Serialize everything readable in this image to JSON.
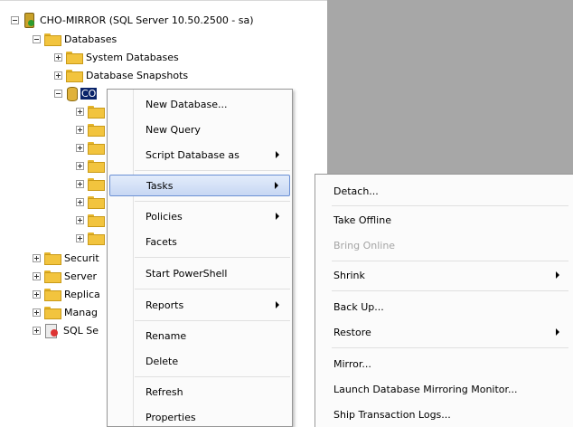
{
  "tree": {
    "server_label": "CHO-MIRROR (SQL Server 10.50.2500 - sa)",
    "databases_label": "Databases",
    "system_databases_label": "System Databases",
    "database_snapshots_label": "Database Snapshots",
    "selected_db_label": "CO",
    "partial_nodes": [
      {
        "label": "Securit"
      },
      {
        "label": "Server"
      },
      {
        "label": "Replica"
      },
      {
        "label": "Manag"
      },
      {
        "label": "SQL Se"
      }
    ]
  },
  "context_menu": {
    "items": [
      {
        "label": "New Database..."
      },
      {
        "label": "New Query"
      },
      {
        "label": "Script Database as"
      },
      {
        "label": "Tasks"
      },
      {
        "label": "Policies"
      },
      {
        "label": "Facets"
      },
      {
        "label": "Start PowerShell"
      },
      {
        "label": "Reports"
      },
      {
        "label": "Rename"
      },
      {
        "label": "Delete"
      },
      {
        "label": "Refresh"
      },
      {
        "label": "Properties"
      }
    ]
  },
  "tasks_submenu": {
    "items": [
      {
        "label": "Detach..."
      },
      {
        "label": "Take Offline"
      },
      {
        "label": "Bring Online"
      },
      {
        "label": "Shrink"
      },
      {
        "label": "Back Up..."
      },
      {
        "label": "Restore"
      },
      {
        "label": "Mirror..."
      },
      {
        "label": "Launch Database Mirroring Monitor..."
      },
      {
        "label": "Ship Transaction Logs..."
      }
    ]
  }
}
